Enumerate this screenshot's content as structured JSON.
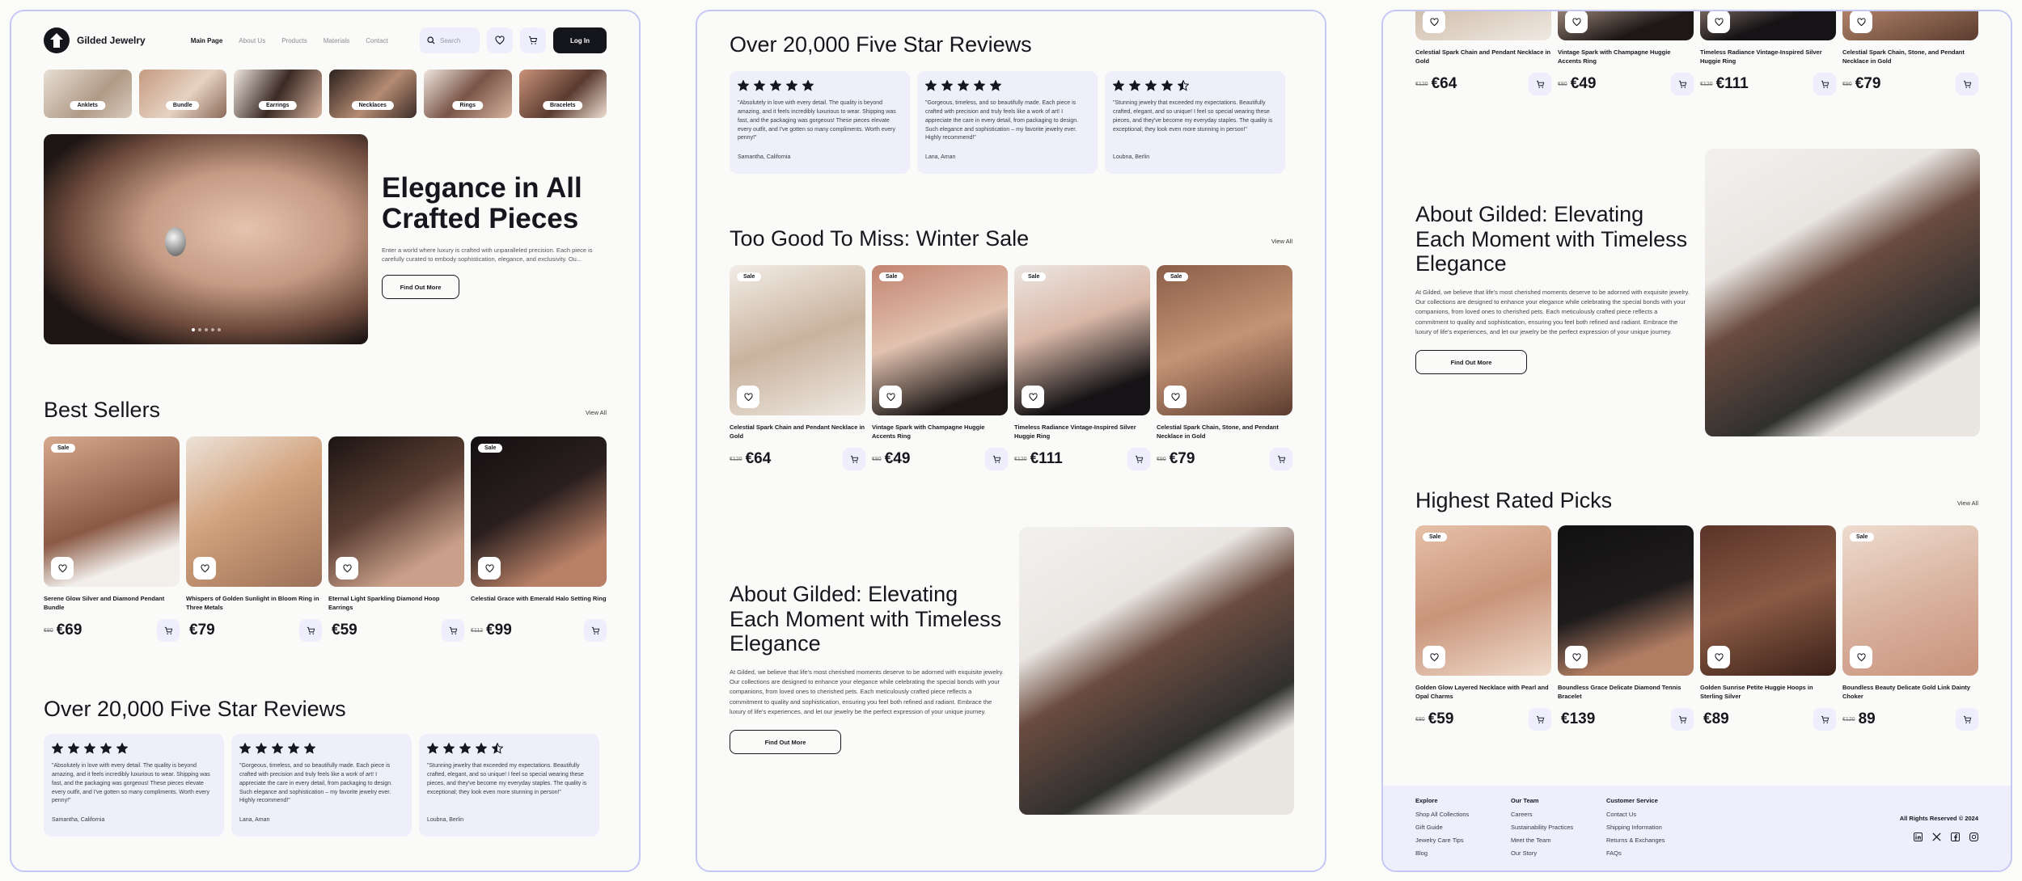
{
  "brand": "Gilded Jewelry",
  "nav": [
    "Main Page",
    "About Us",
    "Products",
    "Materials",
    "Contact"
  ],
  "search_placeholder": "Search",
  "login_label": "Log In",
  "categories": [
    "Anklets",
    "Bundle",
    "Earrings",
    "Necklaces",
    "Rings",
    "Bracelets"
  ],
  "hero": {
    "title": "Elegance in All Crafted Pieces",
    "desc": "Enter a world where luxury is crafted with unparalleled precision. Each piece is carefully curated to embody sophistication, elegance, and exclusivity. Ou...",
    "button": "Find Out More",
    "slides": 5,
    "active_slide": 1
  },
  "best_sellers": {
    "title": "Best Sellers",
    "view_all": "View All",
    "products": [
      {
        "name": "Serene Glow Silver and Diamond Pendant Bundle",
        "old": "€80",
        "price": "€69",
        "sale": true
      },
      {
        "name": "Whispers of Golden Sunlight in Bloom Ring in Three Metals",
        "old": "",
        "price": "€79",
        "sale": false
      },
      {
        "name": "Eternal Light Sparkling Diamond Hoop Earrings",
        "old": "",
        "price": "€59",
        "sale": false
      },
      {
        "name": "Celestial Grace with Emerald Halo Setting Ring",
        "old": "€112",
        "price": "€99",
        "sale": true
      }
    ]
  },
  "reviews": {
    "title": "Over 20,000 Five Star Reviews",
    "items": [
      {
        "stars": 5,
        "text": "\"Absolutely in love with every detail. The quality is beyond amazing, and it feels incredibly luxurious to wear. Shipping was fast, and the packaging was gorgeous! These pieces elevate every outfit, and I've gotten so many compliments. Worth every penny!\"",
        "name": "Samantha, California"
      },
      {
        "stars": 5,
        "text": "\"Gorgeous, timeless, and so beautifully made. Each piece is crafted with precision and truly feels like a work of art! I appreciate the care in every detail, from packaging to design. Such elegance and sophistication – my favorite jewelry ever. Highly recommend!\"",
        "name": "Lana, Aman"
      },
      {
        "stars": 4.5,
        "text": "\"Stunning jewelry that exceeded my expectations. Beautifully crafted, elegant, and so unique! I feel so special wearing these pieces, and they've become my everyday staples. The quality is exceptional; they look even more stunning in person!\"",
        "name": "Loubna, Berlin"
      }
    ]
  },
  "winter_sale": {
    "title": "Too Good To Miss: Winter Sale",
    "view_all": "View All",
    "products": [
      {
        "name": "Celestial Spark Chain and Pendant Necklace in Gold",
        "old": "€120",
        "price": "€64",
        "sale": true
      },
      {
        "name": "Vintage Spark with Champagne Huggie Accents Ring",
        "old": "€80",
        "price": "€49",
        "sale": true
      },
      {
        "name": "Timeless Radiance Vintage-Inspired Silver Huggie Ring",
        "old": "€120",
        "price": "€111",
        "sale": true
      },
      {
        "name": "Celestial Spark Chain, Stone, and Pendant Necklace in Gold",
        "old": "€90",
        "price": "€79",
        "sale": true
      }
    ]
  },
  "about": {
    "title": "About Gilded: Elevating Each Moment with Timeless Elegance",
    "text": "At Gilded, we believe that life's most cherished moments deserve to be adorned with exquisite jewelry. Our collections are designed to enhance your elegance while celebrating the special bonds with your companions, from loved ones to cherished pets. Each meticulously crafted piece reflects a commitment to quality and sophistication, ensuring you feel both refined and radiant. Embrace the luxury of life's experiences, and let our jewelry be the perfect expression of your unique journey.",
    "button": "Find Out More"
  },
  "highest_rated": {
    "title": "Highest Rated Picks",
    "view_all": "View All",
    "products": [
      {
        "name": "Golden Glow Layered Necklace with Pearl and Opal Charms",
        "old": "€80",
        "price": "€59",
        "sale": true
      },
      {
        "name": "Boundless Grace Delicate Diamond Tennis Bracelet",
        "old": "",
        "price": "€139",
        "sale": false
      },
      {
        "name": "Golden Sunrise Petite Huggie Hoops in Sterling Silver",
        "old": "",
        "price": "€89",
        "sale": false
      },
      {
        "name": "Boundless Beauty Delicate Gold Link Dainty Choker",
        "old": "€120",
        "price": "89",
        "sale": true
      }
    ]
  },
  "footer": {
    "columns": [
      {
        "title": "Explore",
        "links": [
          "Shop All Collections",
          "Gift Guide",
          "Jewelry Care Tips",
          "Blog"
        ]
      },
      {
        "title": "Our Team",
        "links": [
          "Careers",
          "Sustainability Practices",
          "Meet the Team",
          "Our Story"
        ]
      },
      {
        "title": "Customer Service",
        "links": [
          "Contact Us",
          "Shipping Information",
          "Returns & Exchanges",
          "FAQs"
        ]
      }
    ],
    "rights": "All Rights Reserved © 2024",
    "socials": [
      "linkedin-icon",
      "x-icon",
      "facebook-icon",
      "instagram-icon"
    ]
  },
  "colors": {
    "accent": "#c5c8f5",
    "card_bg": "#efeffc",
    "dark": "#15151c",
    "background": "#fafaf8"
  }
}
